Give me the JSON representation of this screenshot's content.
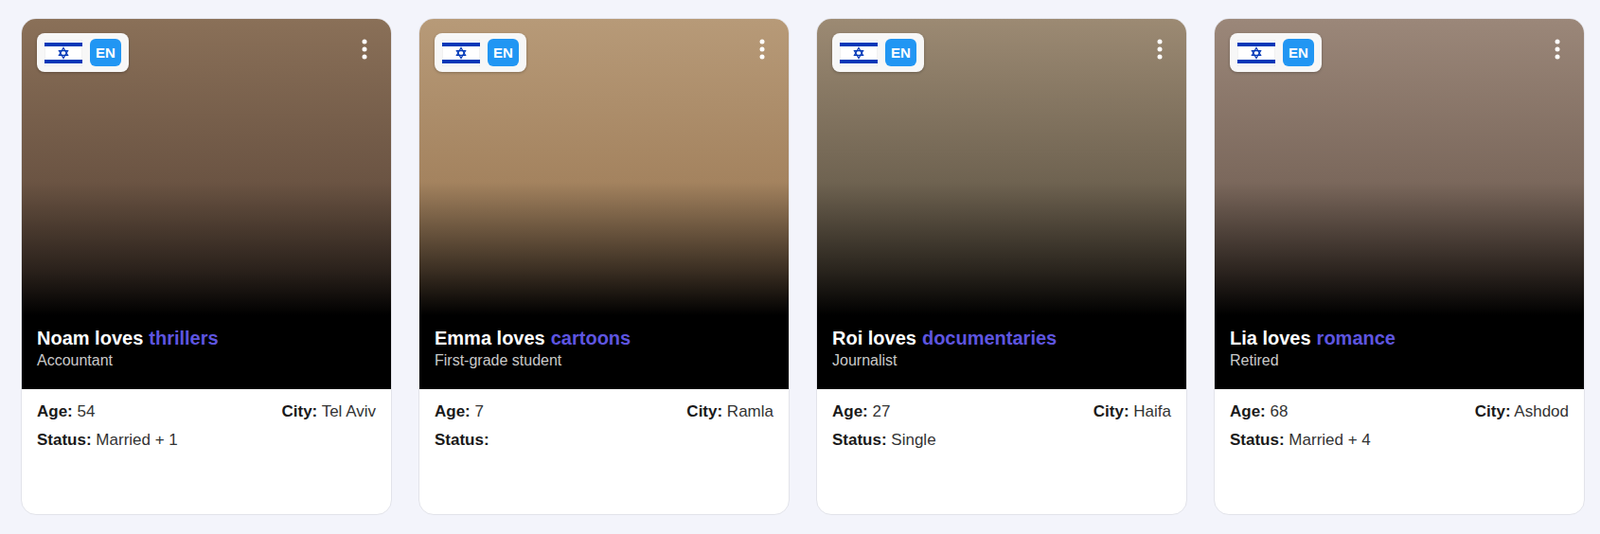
{
  "labels": {
    "age": "Age:",
    "city": "City:",
    "status": "Status:"
  },
  "cards": [
    {
      "language": "EN",
      "title": "Noam loves",
      "genre": "thrillers",
      "occupation": "Accountant",
      "age": "54",
      "city": "Tel Aviv",
      "status": "Married + 1"
    },
    {
      "language": "EN",
      "title": "Emma loves",
      "genre": "cartoons",
      "occupation": "First-grade student",
      "age": "7",
      "city": "Ramla",
      "status": ""
    },
    {
      "language": "EN",
      "title": "Roi loves",
      "genre": "documentaries",
      "occupation": "Journalist",
      "age": "27",
      "city": "Haifa",
      "status": "Single"
    },
    {
      "language": "EN",
      "title": "Lia loves",
      "genre": "romance",
      "occupation": "Retired",
      "age": "68",
      "city": "Ashdod",
      "status": "Married + 4"
    }
  ]
}
